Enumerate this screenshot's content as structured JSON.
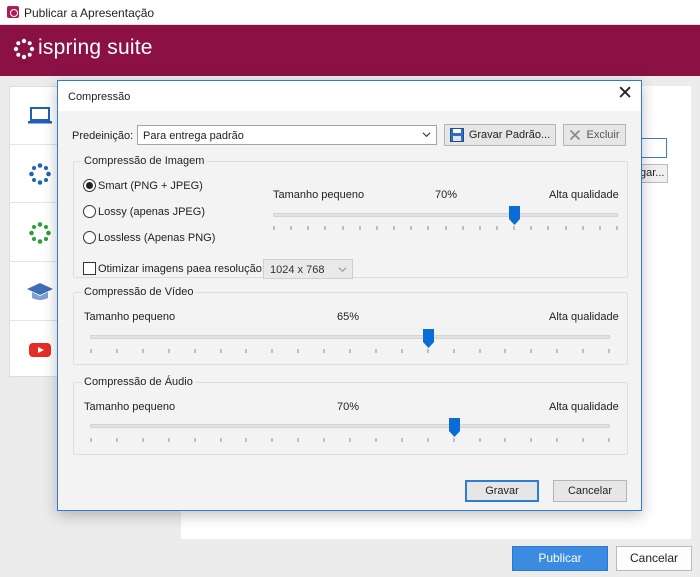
{
  "outer": {
    "title": "Publicar a Apresentação",
    "brand": "ispring suite",
    "background_input_button": "gar...",
    "publish_label": "Publicar",
    "cancel_label": "Cancelar"
  },
  "dialog": {
    "title": "Compressão",
    "preset_label": "Predeinição:",
    "preset_value": "Para entrega padrão",
    "save_preset_label": "Gravar Padrão...",
    "delete_label": "Excluir",
    "image_group": {
      "title": "Compressão de Imagem",
      "options": [
        "Smart (PNG + JPEG)",
        "Lossy (apenas JPEG)",
        "Lossless (Apenas PNG)"
      ],
      "selected_index": 0,
      "slider_min_label": "Tamanho pequeno",
      "slider_value_label": "70%",
      "slider_max_label": "Alta qualidade",
      "slider_value": 70,
      "optimize_label": "Otimizar imagens paea resolução:",
      "optimize_checked": false,
      "resolution_value": "1024 x 768"
    },
    "video_group": {
      "title": "Compressão de Vídeo",
      "slider_min_label": "Tamanho pequeno",
      "slider_value_label": "65%",
      "slider_max_label": "Alta qualidade",
      "slider_value": 65
    },
    "audio_group": {
      "title": "Compressão de Áudio",
      "slider_min_label": "Tamanho pequeno",
      "slider_value_label": "70%",
      "slider_max_label": "Alta qualidade",
      "slider_value": 70
    },
    "save_label": "Gravar",
    "cancel_label": "Cancelar"
  },
  "colors": {
    "brand": "#8b1145",
    "accent": "#2c7dd8",
    "nav_icon_blue": "#2060b8",
    "nav_icon_green": "#2e9e3a",
    "youtube": "#e52d27"
  },
  "nav_icons": [
    "laptop-icon",
    "sparkle-blue-icon",
    "sparkle-green-icon",
    "graduation-cap-icon",
    "youtube-icon"
  ]
}
